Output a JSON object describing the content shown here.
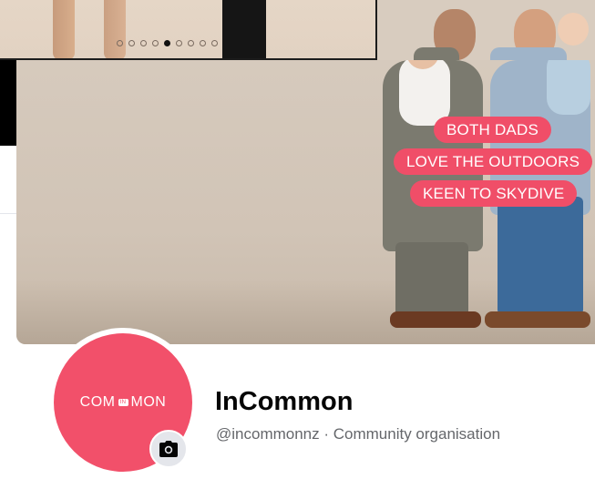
{
  "carousel": {
    "dots_total": 9,
    "active_index": 4
  },
  "cover": {
    "tags": [
      "BOTH DADS",
      "LOVE THE OUTDOORS",
      "KEEN TO SKYDIVE"
    ],
    "tag_color": "#f04e68"
  },
  "profile": {
    "avatar_text_left": "COM",
    "avatar_text_mid": "IN",
    "avatar_text_right": "MON",
    "avatar_color": "#f2506a",
    "camera_icon": "camera-icon",
    "name": "InCommon",
    "handle_category": "@incommonnz · Community organisation"
  }
}
